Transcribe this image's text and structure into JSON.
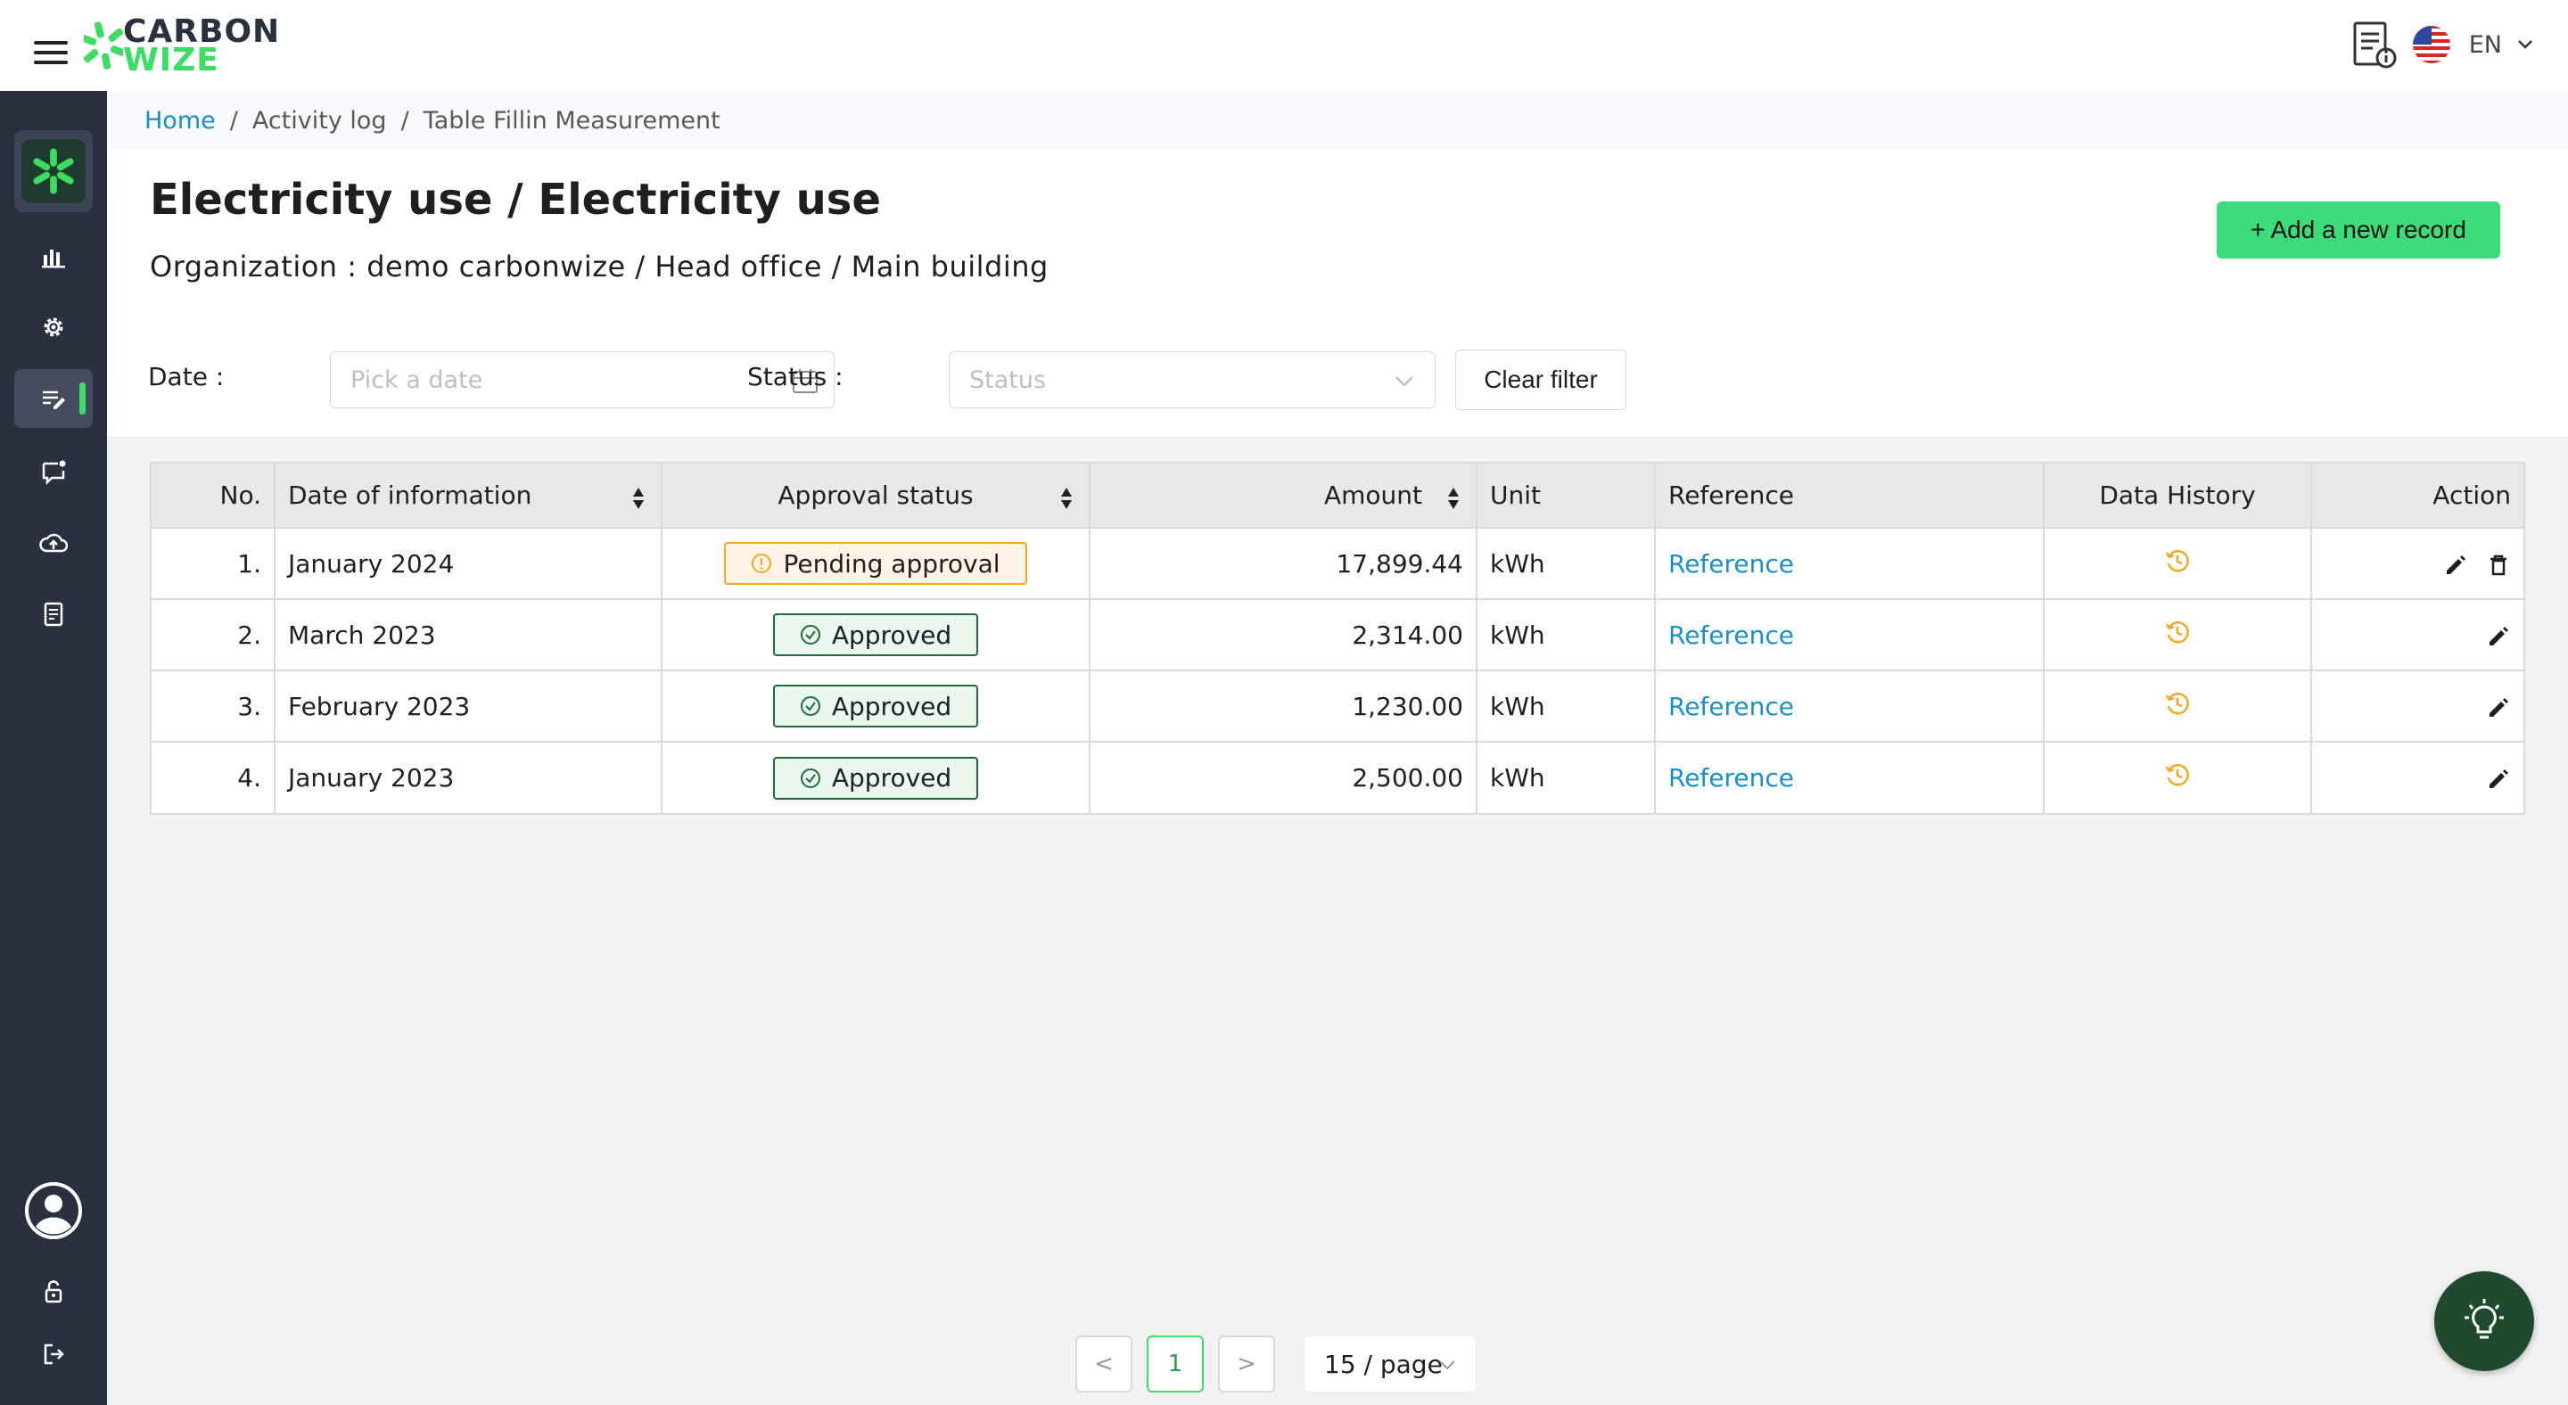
{
  "app": {
    "logo_line1": "CARBON",
    "logo_line2": "WIZE",
    "brand_color": "#3ddc62",
    "sidebar_color": "#2b3040"
  },
  "topbar": {
    "language": "EN",
    "icons": [
      "menu-icon",
      "report-info-icon",
      "us-flag-icon",
      "chevron-down-icon"
    ]
  },
  "sidebar": {
    "items": [
      {
        "icon": "bar-chart-icon"
      },
      {
        "icon": "gear-icon"
      },
      {
        "icon": "edit-list-icon",
        "active": true
      },
      {
        "icon": "chat-notification-icon"
      },
      {
        "icon": "cloud-upload-icon"
      },
      {
        "icon": "document-icon"
      }
    ],
    "bottom": [
      "avatar-icon",
      "lock-icon",
      "logout-icon"
    ]
  },
  "breadcrumb": {
    "home": "Home",
    "activity_log": "Activity log",
    "current": "Table Fillin Measurement"
  },
  "page": {
    "title": "Electricity use / Electricity use",
    "organization": "Organization : demo carbonwize / Head office / Main building",
    "add_button": "Add a new record",
    "add_prefix": "+"
  },
  "filters": {
    "date_label": "Date :",
    "date_placeholder": "Pick a date",
    "status_label": "Status :",
    "status_placeholder": "Status",
    "clear_button": "Clear filter"
  },
  "table": {
    "columns": [
      "No.",
      "Date of information",
      "Approval status",
      "Amount",
      "Unit",
      "Reference",
      "Data History",
      "Action"
    ],
    "rows": [
      {
        "no": "1.",
        "date": "January 2024",
        "status": "Pending approval",
        "status_type": "pending",
        "amount": "17,899.44",
        "unit": "kWh",
        "reference": "Reference",
        "actions": [
          "edit",
          "delete"
        ]
      },
      {
        "no": "2.",
        "date": "March 2023",
        "status": "Approved",
        "status_type": "approved",
        "amount": "2,314.00",
        "unit": "kWh",
        "reference": "Reference",
        "actions": [
          "edit"
        ]
      },
      {
        "no": "3.",
        "date": "February 2023",
        "status": "Approved",
        "status_type": "approved",
        "amount": "1,230.00",
        "unit": "kWh",
        "reference": "Reference",
        "actions": [
          "edit"
        ]
      },
      {
        "no": "4.",
        "date": "January 2023",
        "status": "Approved",
        "status_type": "approved",
        "amount": "2,500.00",
        "unit": "kWh",
        "reference": "Reference",
        "actions": [
          "edit"
        ]
      }
    ],
    "colors": {
      "pending": "#f5a623",
      "approved": "#1e6b34",
      "link": "#1890c8",
      "history": "#f5a623"
    }
  },
  "pagination": {
    "current_page": "1",
    "prev": "<",
    "next": ">",
    "page_size": "15 / page"
  }
}
